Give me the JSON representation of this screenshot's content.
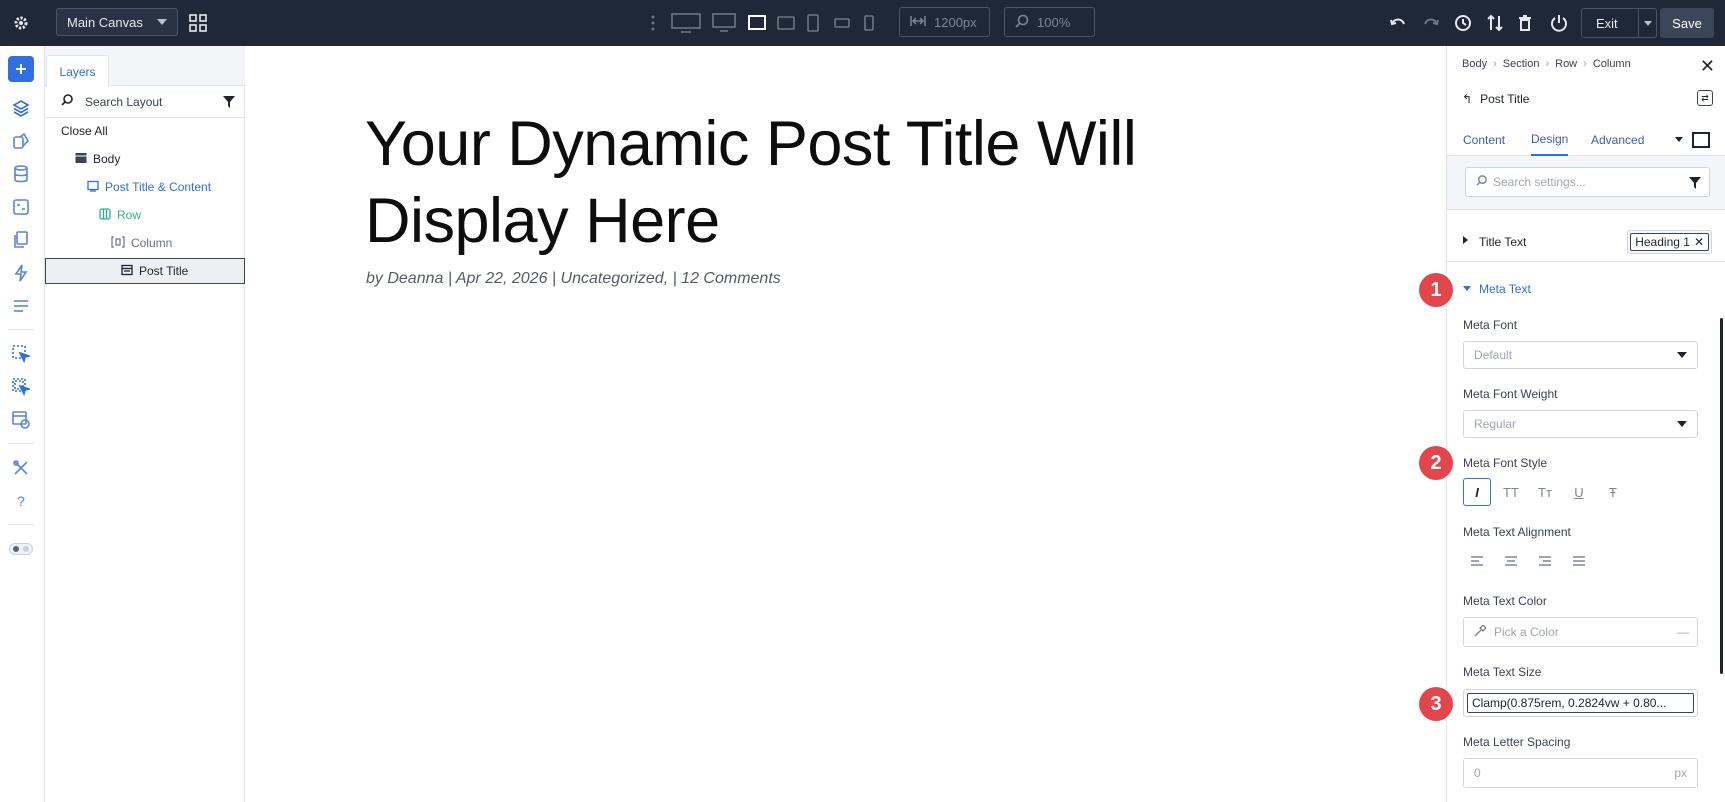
{
  "topbar": {
    "canvas_select": "Main Canvas",
    "width_value": "1200px",
    "zoom_value": "100%",
    "exit_label": "Exit",
    "save_label": "Save"
  },
  "layers": {
    "tab_label": "Layers",
    "search_placeholder": "Search Layout",
    "close_all": "Close All",
    "tree": [
      {
        "label": "Body"
      },
      {
        "label": "Post Title & Content"
      },
      {
        "label": "Row"
      },
      {
        "label": "Column"
      },
      {
        "label": "Post Title"
      }
    ]
  },
  "canvas": {
    "title": "Your Dynamic Post Title Will Display Here",
    "meta": "by Deanna | Apr 22, 2026 | Uncategorized, | 12 Comments"
  },
  "settings": {
    "breadcrumb": [
      "Body",
      "Section",
      "Row",
      "Column"
    ],
    "module_title": "Post Title",
    "tabs": [
      "Content",
      "Design",
      "Advanced"
    ],
    "active_tab": "Design",
    "search_placeholder": "Search settings...",
    "title_text_group": "Title Text",
    "title_text_tag": "Heading 1",
    "meta_text_group": "Meta Text",
    "meta_font_label": "Meta Font",
    "meta_font_value": "Default",
    "meta_font_weight_label": "Meta Font Weight",
    "meta_font_weight_value": "Regular",
    "meta_font_style_label": "Meta Font Style",
    "meta_text_alignment_label": "Meta Text Alignment",
    "meta_text_color_label": "Meta Text Color",
    "meta_text_color_placeholder": "Pick a Color",
    "meta_text_size_label": "Meta Text Size",
    "meta_text_size_value": "Clamp(0.875rem, 0.2824vw + 0.80...",
    "meta_letter_spacing_label": "Meta Letter Spacing",
    "meta_letter_spacing_value": "0",
    "meta_letter_spacing_unit": "px",
    "font_style_buttons": [
      "I",
      "TT",
      "Tт",
      "U",
      "Ŧ"
    ]
  },
  "callouts": [
    "1",
    "2",
    "3"
  ],
  "colors": {
    "accent": "#2f6fe0",
    "topbar": "#1f2837",
    "badge": "#e2464c",
    "row_green": "#2db38a"
  }
}
